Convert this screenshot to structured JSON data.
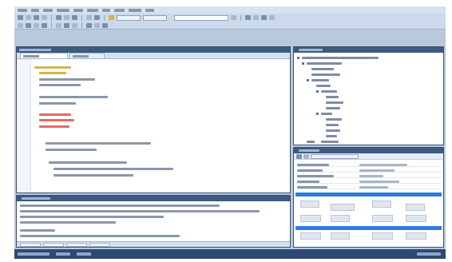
{
  "window": {
    "title": ""
  },
  "menu": {
    "items": [
      {
        "label": ""
      },
      {
        "label": ""
      },
      {
        "label": ""
      },
      {
        "label": ""
      },
      {
        "label": ""
      },
      {
        "label": ""
      },
      {
        "label": ""
      },
      {
        "label": ""
      },
      {
        "label": ""
      },
      {
        "label": ""
      }
    ]
  },
  "toolbar": {
    "search_value": "",
    "search_placeholder": "",
    "config_value": "",
    "platform_value": ""
  },
  "editor": {
    "tabs": [
      {
        "label": ""
      },
      {
        "label": ""
      }
    ],
    "lines": [
      {
        "text": "",
        "kind": "keyword"
      },
      {
        "text": "",
        "kind": "keyword"
      },
      {
        "text": "",
        "kind": "code"
      },
      {
        "text": "",
        "kind": "code"
      },
      {
        "text": "",
        "kind": "code"
      },
      {
        "text": "",
        "kind": "code"
      },
      {
        "text": "",
        "kind": "string"
      },
      {
        "text": "",
        "kind": "string"
      },
      {
        "text": "",
        "kind": "string"
      },
      {
        "text": "",
        "kind": "code"
      },
      {
        "text": "",
        "kind": "code"
      },
      {
        "text": "",
        "kind": "code"
      },
      {
        "text": "",
        "kind": "code"
      },
      {
        "text": "",
        "kind": "code"
      }
    ]
  },
  "tree": {
    "title": "",
    "nodes": [
      {
        "label": ""
      },
      {
        "label": ""
      },
      {
        "label": ""
      },
      {
        "label": ""
      },
      {
        "label": ""
      },
      {
        "label": ""
      },
      {
        "label": ""
      },
      {
        "label": ""
      },
      {
        "label": ""
      },
      {
        "label": ""
      },
      {
        "label": ""
      },
      {
        "label": ""
      },
      {
        "label": ""
      },
      {
        "label": ""
      },
      {
        "label": ""
      },
      {
        "label": ""
      },
      {
        "label": ""
      }
    ]
  },
  "properties": {
    "title": "",
    "rows": [
      {
        "name": "",
        "value": ""
      },
      {
        "name": "",
        "value": ""
      },
      {
        "name": "",
        "value": ""
      },
      {
        "name": "",
        "value": ""
      },
      {
        "name": "",
        "value": ""
      }
    ]
  },
  "output": {
    "title": "",
    "tabs": [
      {
        "label": ""
      },
      {
        "label": ""
      },
      {
        "label": ""
      },
      {
        "label": ""
      }
    ],
    "lines": [
      {
        "text": ""
      },
      {
        "text": ""
      },
      {
        "text": ""
      },
      {
        "text": ""
      },
      {
        "text": ""
      },
      {
        "text": ""
      }
    ]
  },
  "status": {
    "left_text": "",
    "right_text": ""
  },
  "colors": {
    "chrome": "#b9c9dc",
    "panel_title": "#3d5a80",
    "status_bar": "#2b4a73",
    "selection": "#2f7be0",
    "keyword": "#d9b24a",
    "string": "#e06b6b",
    "code": "#7d8ca1"
  }
}
